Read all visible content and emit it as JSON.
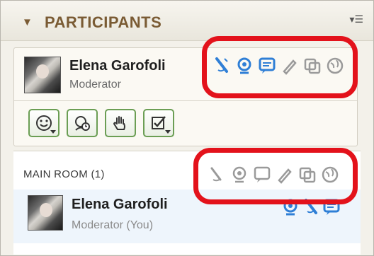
{
  "header": {
    "title": "PARTICIPANTS",
    "collapse_icon": "triangle-down-icon",
    "menu_icon": "list-menu-icon"
  },
  "moderator_card": {
    "name": "Elena Garofoli",
    "role": "Moderator",
    "status_icons": [
      "speaker-icon",
      "webcam-icon",
      "chat-icon",
      "pencil-icon",
      "copy-icon",
      "globe-icon"
    ],
    "tools": [
      "emoticon-button",
      "timer-button",
      "raise-hand-button",
      "checkbox-button"
    ]
  },
  "main_room": {
    "label": "MAIN ROOM (1)",
    "header_icons": [
      "speaker-icon",
      "webcam-icon",
      "chat-icon",
      "pencil-icon",
      "copy-icon",
      "globe-icon"
    ],
    "participant": {
      "name": "Elena Garofoli",
      "role": "Moderator (You)",
      "status_icons": [
        "webcam-icon",
        "speaker-icon",
        "chat-icon"
      ]
    }
  },
  "colors": {
    "brand_brown": "#7a5b34",
    "active_blue": "#2f7fd6",
    "highlight_red": "#e3121b",
    "tool_green": "#6b9e54"
  }
}
